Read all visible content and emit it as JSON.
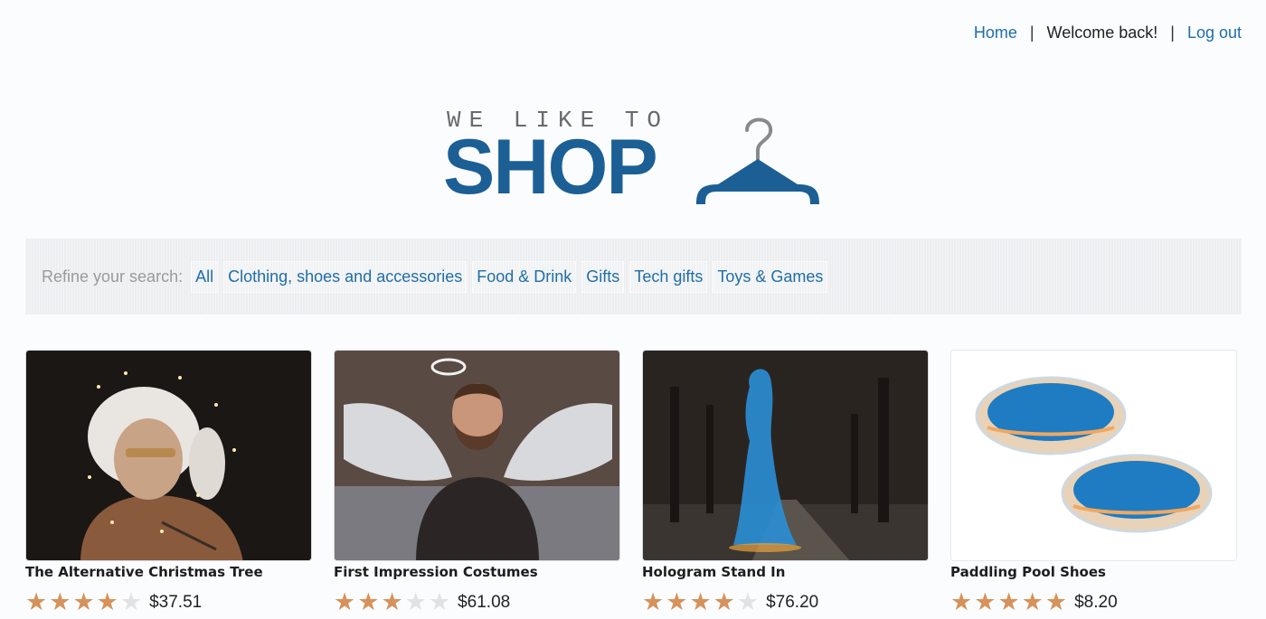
{
  "nav": {
    "home": "Home",
    "separator": "|",
    "welcome": "Welcome back!",
    "logout": "Log out"
  },
  "logo": {
    "tagline": "WE LIKE TO",
    "word": "SHOP",
    "icon": "hanger-icon"
  },
  "refine": {
    "label": "Refine your search:",
    "categories": [
      "All",
      "Clothing, shoes and accessories",
      "Food & Drink",
      "Gifts",
      "Tech gifts",
      "Toys & Games"
    ]
  },
  "products": [
    {
      "name": "The Alternative Christmas Tree",
      "rating": 4,
      "max_rating": 5,
      "price": "$37.51"
    },
    {
      "name": "First Impression Costumes",
      "rating": 3,
      "max_rating": 5,
      "price": "$61.08"
    },
    {
      "name": "Hologram Stand In",
      "rating": 4,
      "max_rating": 5,
      "price": "$76.20"
    },
    {
      "name": "Paddling Pool Shoes",
      "rating": 5,
      "max_rating": 5,
      "price": "$8.20"
    }
  ],
  "colors": {
    "brand": "#1b5f95",
    "link": "#1f6ea8",
    "star_on": "#d6925a",
    "star_off": "#e2e2e2"
  }
}
